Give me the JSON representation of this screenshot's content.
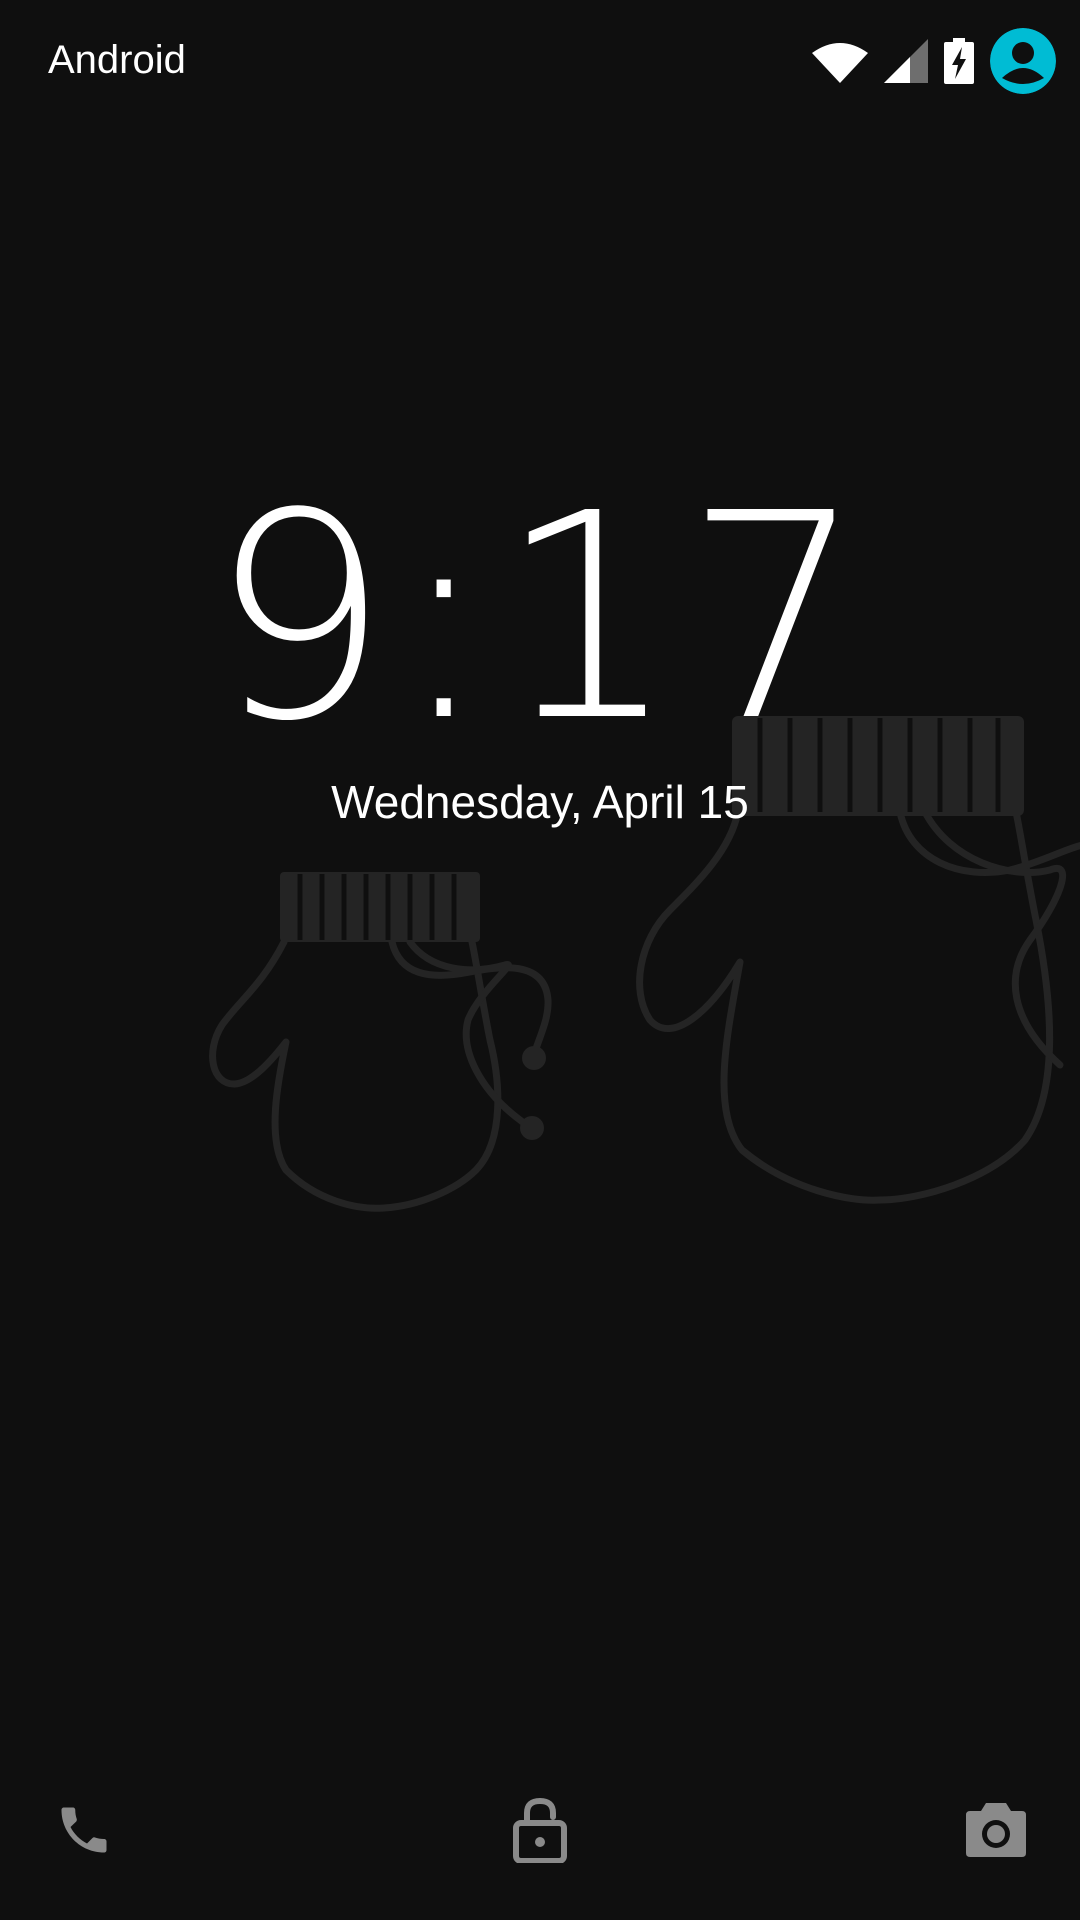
{
  "status_bar": {
    "carrier": "Android",
    "icons": [
      "wifi-icon",
      "cell-signal-icon",
      "battery-charging-icon",
      "user-avatar-icon"
    ]
  },
  "lockscreen": {
    "time": "9:17",
    "date": "Wednesday, April 15"
  },
  "bottom_actions": {
    "icons": [
      "phone-icon",
      "lock-icon",
      "camera-icon"
    ]
  },
  "colors": {
    "background": "#0f0f0f",
    "text": "#ffffff",
    "accent": "#00bcd4",
    "wallpaper_lines": "#242424",
    "bottom_icons": "#8a8a8a"
  }
}
